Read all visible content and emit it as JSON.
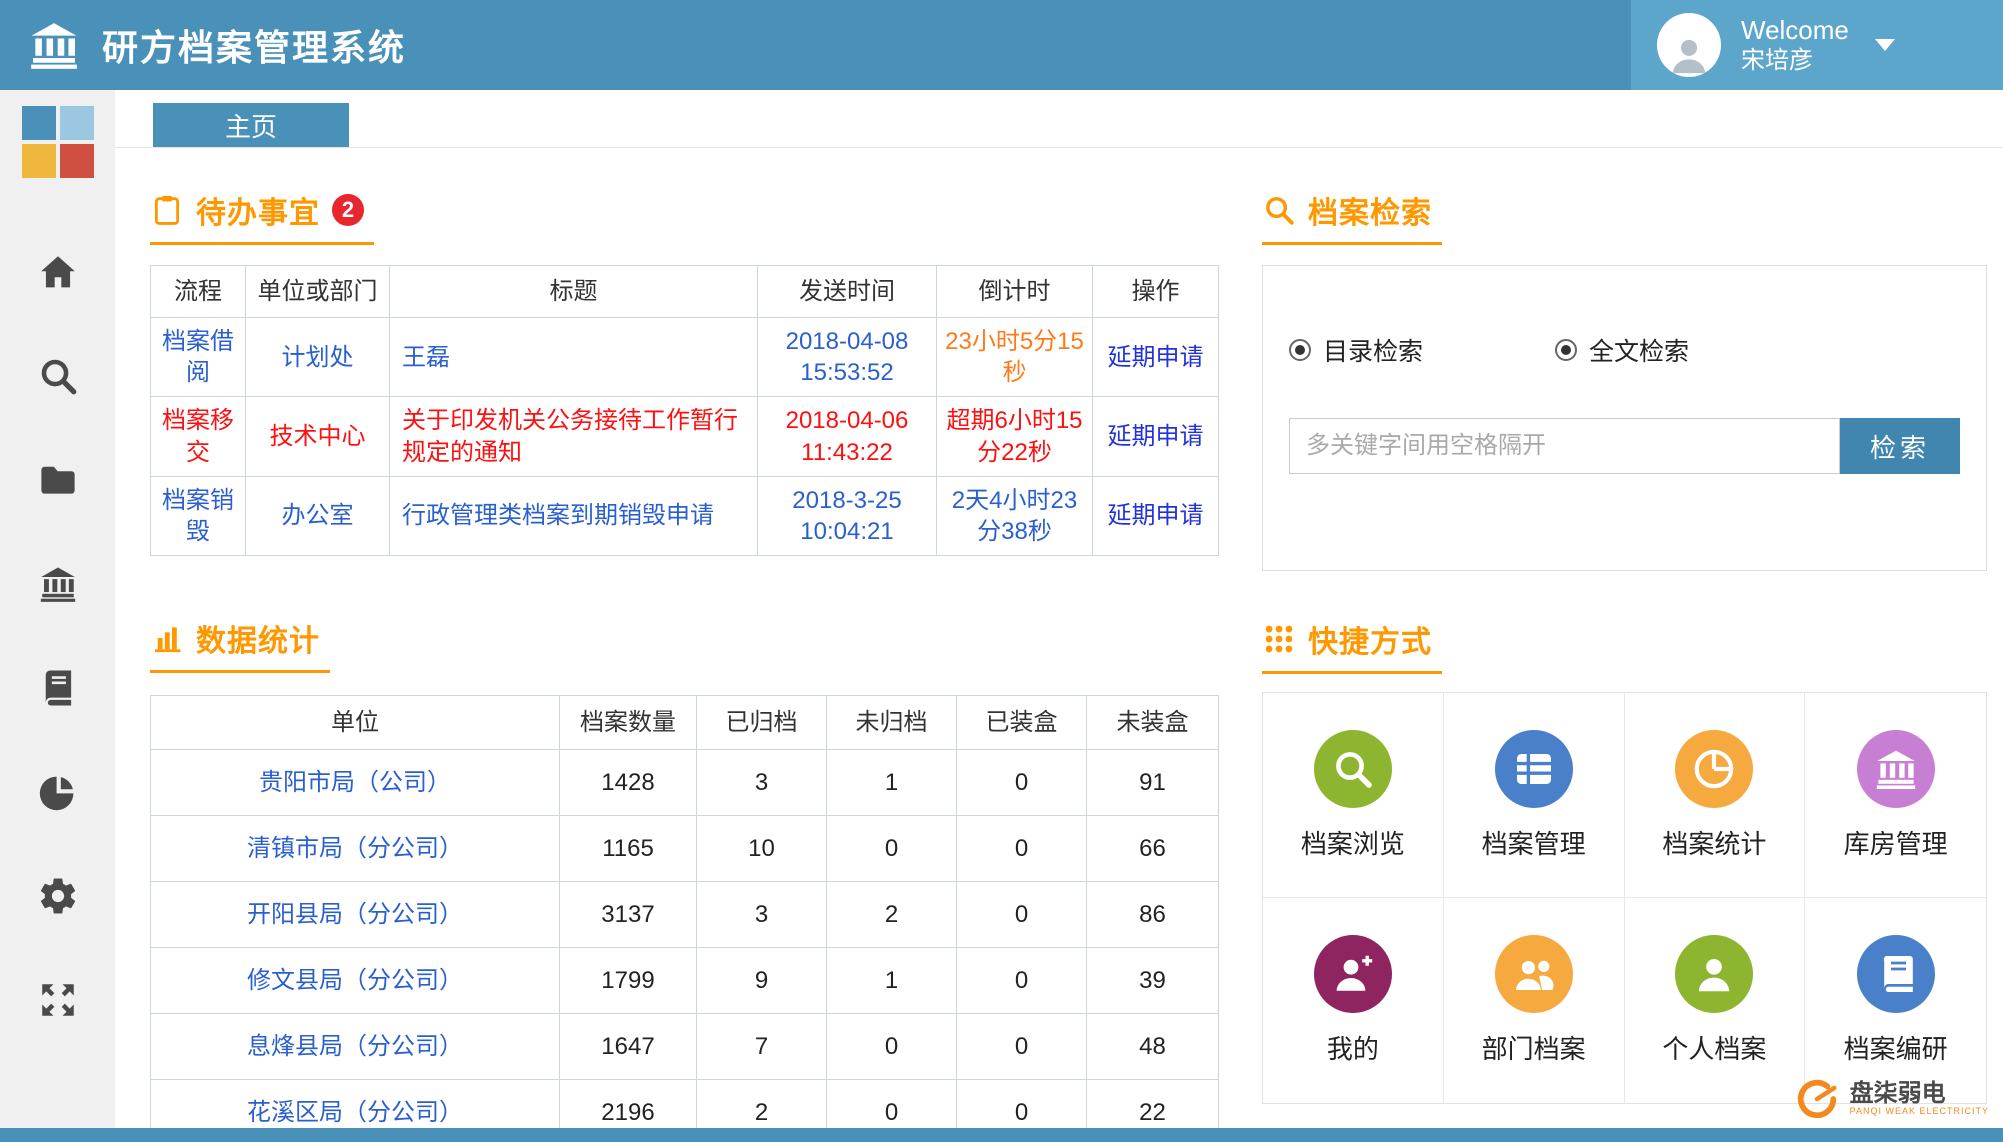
{
  "colors": {
    "blue": "#2a5fd0",
    "red": "#fe1010",
    "orange": "#ff7a1a",
    "link": "#2333d9",
    "accent": "#ff9800"
  },
  "header": {
    "title": "研方档案管理系统",
    "welcome": "Welcome",
    "username": "宋培彦"
  },
  "tabs": [
    {
      "label": "主页"
    }
  ],
  "todo": {
    "title": "待办事宜",
    "badge": "2",
    "columns": [
      "流程",
      "单位或部门",
      "标题",
      "发送时间",
      "倒计时",
      "操作"
    ],
    "rows": [
      {
        "process": "档案借阅",
        "dept": "计划处",
        "subject": "王磊",
        "time": "2018-04-08 15:53:52",
        "countdown": "23小时5分15秒",
        "action": "延期申请",
        "text_color": "blue",
        "countdown_color": "orange"
      },
      {
        "process": "档案移交",
        "dept": "技术中心",
        "subject": "关于印发机关公务接待工作暂行规定的通知",
        "time": "2018-04-06 11:43:22",
        "countdown": "超期6小时15分22秒",
        "action": "延期申请",
        "text_color": "red",
        "countdown_color": "red"
      },
      {
        "process": "档案销毁",
        "dept": "办公室",
        "subject": "行政管理类档案到期销毁申请",
        "time": "2018-3-25 10:04:21",
        "countdown": "2天4小时23分38秒",
        "action": "延期申请",
        "text_color": "blue",
        "countdown_color": "blue"
      }
    ]
  },
  "stats": {
    "title": "数据统计",
    "columns": [
      "单位",
      "档案数量",
      "已归档",
      "未归档",
      "已装盒",
      "未装盒"
    ],
    "rows": [
      {
        "unit": "贵阳市局（公司）",
        "values": [
          "1428",
          "3",
          "1",
          "0",
          "91"
        ]
      },
      {
        "unit": "清镇市局（分公司）",
        "values": [
          "1165",
          "10",
          "0",
          "0",
          "66"
        ]
      },
      {
        "unit": "开阳县局（分公司）",
        "values": [
          "3137",
          "3",
          "2",
          "0",
          "86"
        ]
      },
      {
        "unit": "修文县局（分公司）",
        "values": [
          "1799",
          "9",
          "1",
          "0",
          "39"
        ]
      },
      {
        "unit": "息烽县局（分公司）",
        "values": [
          "1647",
          "7",
          "0",
          "0",
          "48"
        ]
      },
      {
        "unit": "花溪区局（分公司）",
        "values": [
          "2196",
          "2",
          "0",
          "0",
          "22"
        ]
      }
    ]
  },
  "search": {
    "title": "档案检索",
    "options": [
      {
        "label": "目录检索",
        "checked": true
      },
      {
        "label": "全文检索",
        "checked": true
      }
    ],
    "placeholder": "多关键字间用空格隔开",
    "button": "检索"
  },
  "shortcuts": {
    "title": "快捷方式",
    "items": [
      {
        "label": "档案浏览",
        "icon": "magnifier",
        "color": "#8db52f"
      },
      {
        "label": "档案管理",
        "icon": "table",
        "color": "#4a80c9"
      },
      {
        "label": "档案统计",
        "icon": "pie",
        "color": "#f5a93f"
      },
      {
        "label": "库房管理",
        "icon": "bank",
        "color": "#c67fd2"
      },
      {
        "label": "我的",
        "icon": "person-plus",
        "color": "#8e2460"
      },
      {
        "label": "部门档案",
        "icon": "people",
        "color": "#f5a93f"
      },
      {
        "label": "个人档案",
        "icon": "person",
        "color": "#8db52f"
      },
      {
        "label": "档案编研",
        "icon": "book",
        "color": "#4a80c9"
      }
    ]
  },
  "watermark": {
    "name": "盘柒弱电",
    "sub": "PANQI WEAK ELECTRICITY"
  }
}
